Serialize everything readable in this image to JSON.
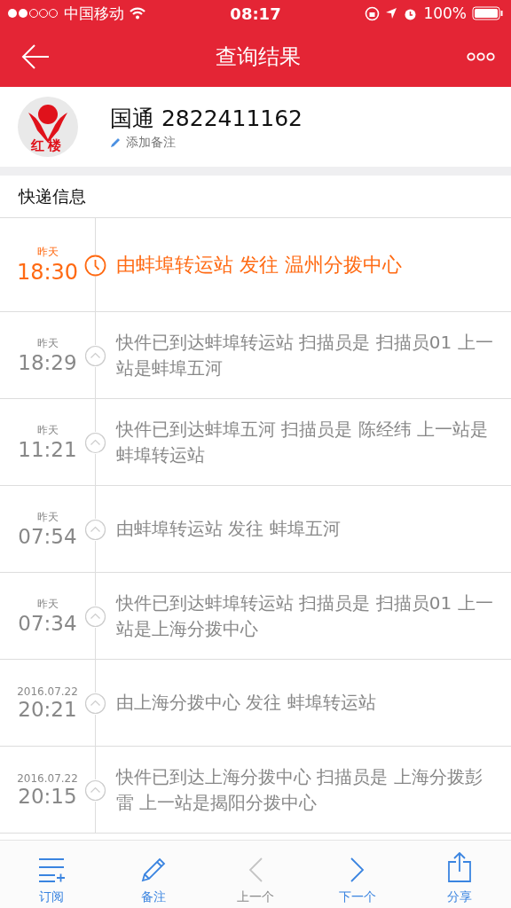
{
  "status_bar": {
    "carrier": "中国移动",
    "time": "08:17",
    "battery": "100%"
  },
  "nav": {
    "title": "查询结果"
  },
  "parcel": {
    "logo_text": "红楼",
    "title": "国通 2822411162",
    "note_link": "添加备注"
  },
  "section_title": "快递信息",
  "events": [
    {
      "day": "昨天",
      "time": "18:30",
      "text": "由蚌埠转运站 发往 温州分拨中心",
      "current": true
    },
    {
      "day": "昨天",
      "time": "18:29",
      "text": "快件已到达蚌埠转运站 扫描员是 扫描员01 上一站是蚌埠五河",
      "current": false
    },
    {
      "day": "昨天",
      "time": "11:21",
      "text": "快件已到达蚌埠五河 扫描员是 陈经纬 上一站是蚌埠转运站",
      "current": false
    },
    {
      "day": "昨天",
      "time": "07:54",
      "text": "由蚌埠转运站 发往 蚌埠五河",
      "current": false
    },
    {
      "day": "昨天",
      "time": "07:34",
      "text": "快件已到达蚌埠转运站 扫描员是 扫描员01 上一站是上海分拨中心",
      "current": false
    },
    {
      "day": "2016.07.22",
      "time": "20:21",
      "text": "由上海分拨中心 发往 蚌埠转运站",
      "current": false
    },
    {
      "day": "2016.07.22",
      "time": "20:15",
      "text": "快件已到达上海分拨中心 扫描员是 上海分拨彭雷 上一站是揭阳分拨中心",
      "current": false
    }
  ],
  "toolbar": [
    {
      "kind": "subscribe",
      "label": "订阅",
      "disabled": false
    },
    {
      "kind": "note",
      "label": "备注",
      "disabled": false
    },
    {
      "kind": "previous",
      "label": "上一个",
      "disabled": true
    },
    {
      "kind": "next",
      "label": "下一个",
      "disabled": false
    },
    {
      "kind": "share",
      "label": "分享",
      "disabled": false
    }
  ]
}
